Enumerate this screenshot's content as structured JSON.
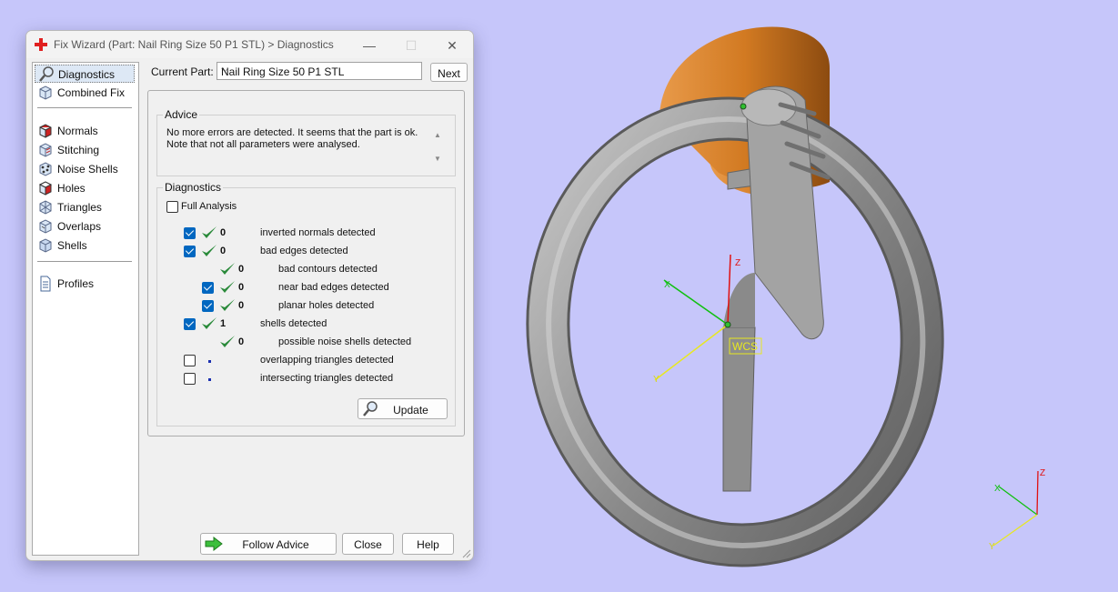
{
  "window": {
    "title": "Fix Wizard (Part: Nail Ring Size 50 P1 STL) > Diagnostics",
    "minimize_glyph": "—",
    "maximize_glyph": "☐",
    "close_glyph": "✕"
  },
  "nav": {
    "items": [
      {
        "label": "Diagnostics",
        "icon": "magnifier-icon",
        "selected": true
      },
      {
        "label": "Combined Fix",
        "icon": "cube-icon"
      },
      {
        "label": "Normals",
        "icon": "normals-cube-icon"
      },
      {
        "label": "Stitching",
        "icon": "stitching-icon"
      },
      {
        "label": "Noise Shells",
        "icon": "noise-shells-icon"
      },
      {
        "label": "Holes",
        "icon": "holes-cube-icon"
      },
      {
        "label": "Triangles",
        "icon": "triangles-icon"
      },
      {
        "label": "Overlaps",
        "icon": "overlaps-icon"
      },
      {
        "label": "Shells",
        "icon": "shells-icon"
      },
      {
        "label": "Profiles",
        "icon": "document-icon"
      }
    ]
  },
  "current_part": {
    "label": "Current Part:",
    "value": "Nail Ring Size 50 P1 STL",
    "next_label": "Next"
  },
  "advice": {
    "title": "Advice",
    "text": "No more errors are detected. It seems that the part is ok. Note that not all parameters were analysed."
  },
  "diagnostics": {
    "title": "Diagnostics",
    "full_analysis_label": "Full Analysis",
    "full_analysis_checked": false,
    "rows": [
      {
        "checkbox": true,
        "checked": true,
        "status": "ok",
        "count": "0",
        "text": "inverted normals detected",
        "indent": 0
      },
      {
        "checkbox": true,
        "checked": true,
        "status": "ok",
        "count": "0",
        "text": "bad edges detected",
        "indent": 0
      },
      {
        "checkbox": false,
        "checked": false,
        "status": "ok",
        "count": "0",
        "text": "bad contours detected",
        "indent": 1
      },
      {
        "checkbox": true,
        "checked": true,
        "status": "ok",
        "count": "0",
        "text": "near bad edges detected",
        "indent": 1
      },
      {
        "checkbox": true,
        "checked": true,
        "status": "ok",
        "count": "0",
        "text": "planar holes detected",
        "indent": 1
      },
      {
        "checkbox": true,
        "checked": true,
        "status": "ok",
        "count": "1",
        "text": "shells detected",
        "indent": 0
      },
      {
        "checkbox": false,
        "checked": false,
        "status": "ok",
        "count": "0",
        "text": "possible noise shells detected",
        "indent": 1
      },
      {
        "checkbox": true,
        "checked": false,
        "status": "pending",
        "count": "",
        "text": "overlapping triangles detected",
        "indent": 0
      },
      {
        "checkbox": true,
        "checked": false,
        "status": "pending",
        "count": "",
        "text": "intersecting triangles detected",
        "indent": 0
      }
    ],
    "update_label": "Update"
  },
  "footer": {
    "follow_advice_label": "Follow Advice",
    "close_label": "Close",
    "help_label": "Help"
  },
  "viewport": {
    "wcs_label": "WCS",
    "axis_x": "X",
    "axis_y": "Y",
    "axis_z": "Z",
    "background": "#c6c6fa",
    "model_color": "#8a8a8a",
    "base_color": "#d27a22"
  }
}
